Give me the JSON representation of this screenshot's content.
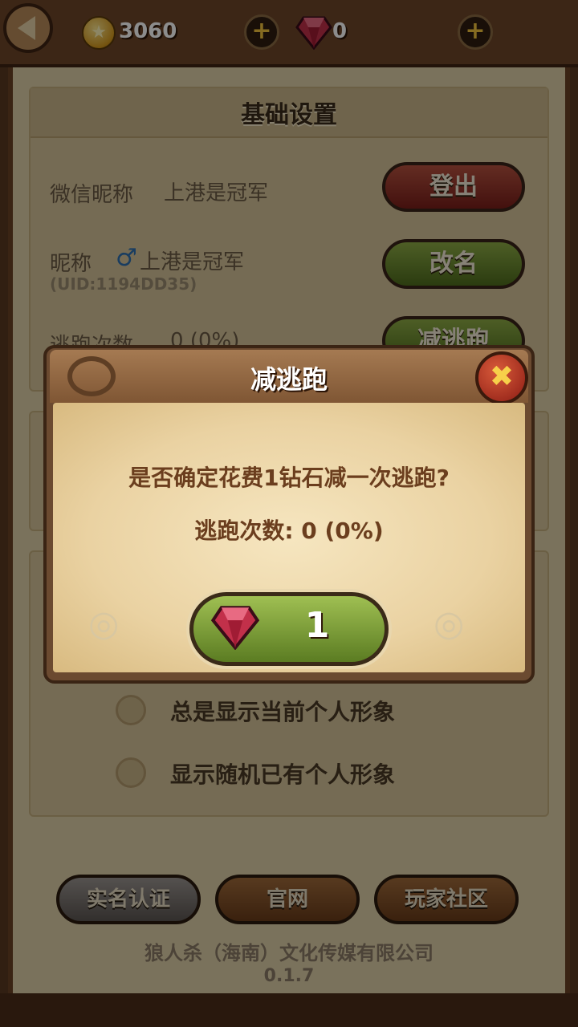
{
  "topbar": {
    "coins": "3060",
    "gems": "0",
    "coin_plus": "+",
    "gem_plus": "+"
  },
  "settings": {
    "title": "基础设置",
    "wechat_label": "微信昵称",
    "wechat_value": "上港是冠军",
    "logout_button": "登出",
    "nickname_label": "昵称",
    "gender_symbol": "♂",
    "nickname_value": "上港是冠军",
    "uid": "(UID:1194DD35)",
    "rename_button": "改名",
    "escape_label": "逃跑次数",
    "escape_value": "0 (0%)",
    "reduce_escape_button": "减逃跑"
  },
  "appearance": {
    "options": [
      "总是显示当前个人形象",
      "显示随机已有个人形象"
    ]
  },
  "footer": {
    "realname_button": "实名认证",
    "website_button": "官网",
    "community_button": "玩家社区",
    "company": "狼人杀（海南）文化传媒有限公司",
    "version": "0.1.7"
  },
  "dialog": {
    "title": "减逃跑",
    "close": "✖",
    "message": "是否确定花费1钻石减一次逃跑?",
    "count_label": "逃跑次数:",
    "count_value": "0 (0%)",
    "confirm_value": "1"
  }
}
